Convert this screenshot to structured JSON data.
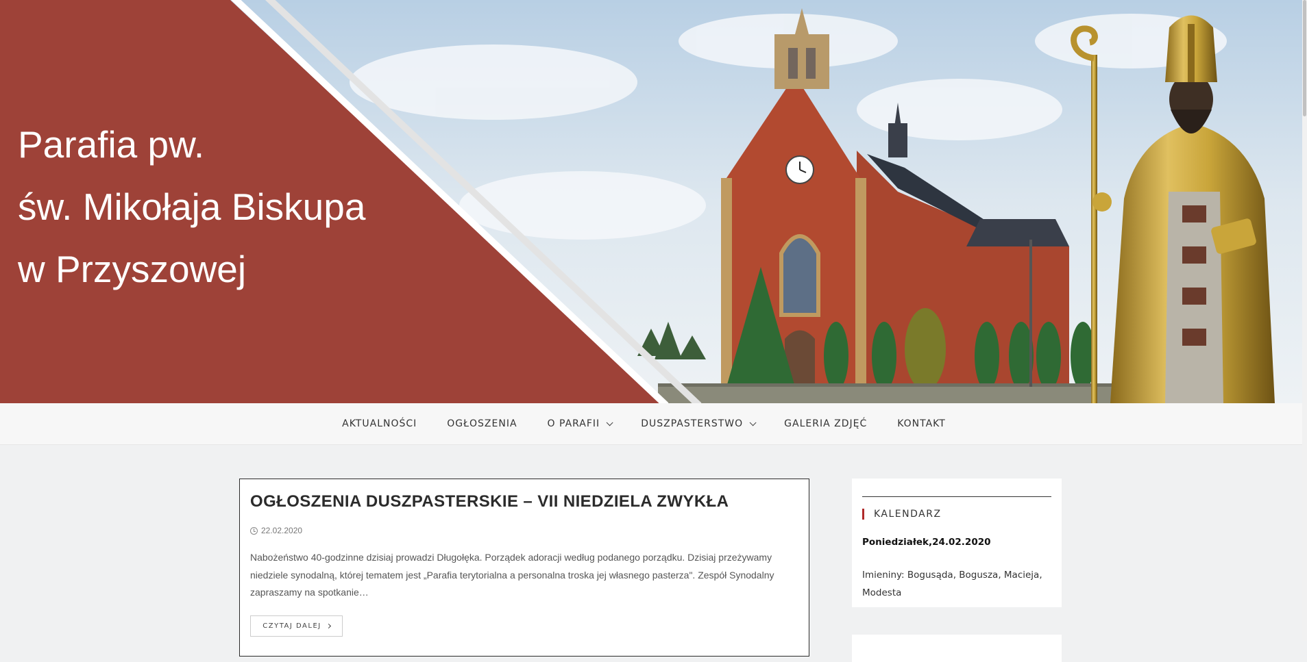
{
  "header": {
    "title_lines": [
      "Parafia pw.",
      "św. Mikołaja Biskupa",
      "w Przyszowej"
    ],
    "banner_color": "#9e4238"
  },
  "nav": {
    "items": [
      {
        "label": "AKTUALNOŚCI",
        "has_dropdown": false
      },
      {
        "label": "OGŁOSZENIA",
        "has_dropdown": false
      },
      {
        "label": "O PARAFII",
        "has_dropdown": true
      },
      {
        "label": "DUSZPASTERSTWO",
        "has_dropdown": true
      },
      {
        "label": "GALERIA ZDJĘĆ",
        "has_dropdown": false
      },
      {
        "label": "KONTAKT",
        "has_dropdown": false
      }
    ]
  },
  "article": {
    "title": "OGŁOSZENIA DUSZPASTERSKIE – VII NIEDZIELA ZWYKŁA",
    "date": "22.02.2020",
    "excerpt": "Nabożeństwo 40-godzinne dzisiaj prowadzi Długołęka. Porządek adoracji według podanego porządku. Dzisiaj przeżywamy niedziele synodalną, której tematem jest „Parafia terytorialna a personalna troska jej własnego pasterza\". Zespół Synodalny zapraszamy na spotkanie…",
    "read_more": "CZYTAJ DALEJ"
  },
  "sidebar": {
    "widget_title": "KALENDARZ",
    "date": "Poniedziałek,24.02.2020",
    "names": "Imieniny: Bogusąda, Bogusza, Macieja, Modesta"
  },
  "icons": {
    "clock": "clock-icon",
    "dropdown": "chevron-down-icon",
    "read_more_arrow": "chevron-right-icon"
  },
  "colors": {
    "accent": "#b02a2a",
    "banner": "#9e4238",
    "page_bg": "#f0f1f2"
  }
}
